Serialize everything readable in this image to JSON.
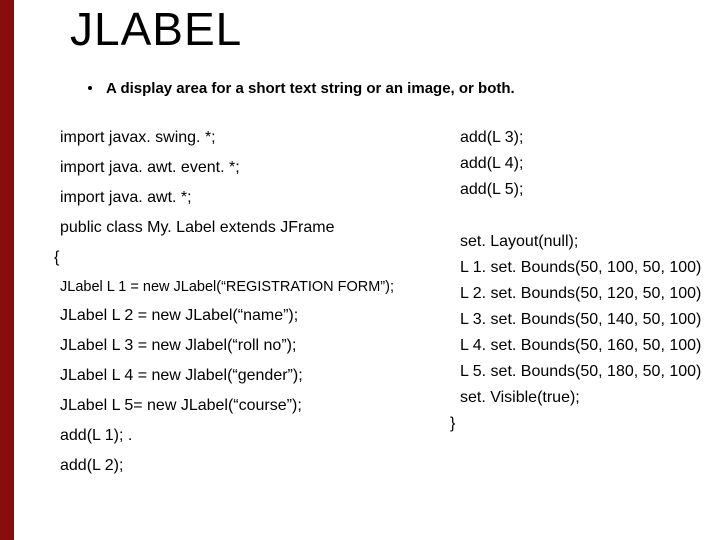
{
  "title": "JLABEL",
  "bullet": "A display area for a short text string or an image, or both.",
  "left": {
    "l1": "import javax. swing. *;",
    "l2": "import java. awt. event. *;",
    "l3": "import java. awt. *;",
    "l4": "public class My. Label extends JFrame",
    "l5": "{",
    "l6": "JLabel L 1 = new JLabel(“REGISTRATION FORM”);",
    "l7": "JLabel L 2 = new JLabel(“name”);",
    "l8": "JLabel L 3 = new Jlabel(“roll no”);",
    "l9": "JLabel L 4 = new Jlabel(“gender”);",
    "l10": "JLabel L 5= new JLabel(“course”);",
    "l11": "add(L 1);   .",
    "l12": "add(L 2);"
  },
  "right": {
    "r1": "add(L 3);",
    "r2": "add(L 4);",
    "r3": "add(L 5);",
    "r4": "set. Layout(null);",
    "r5": "L 1. set. Bounds(50, 100, 50, 100)",
    "r6": "L 2. set. Bounds(50, 120, 50, 100)",
    "r7": "L 3. set. Bounds(50, 140, 50, 100)",
    "r8": "L 4. set. Bounds(50, 160, 50, 100)",
    "r9": "L 5. set. Bounds(50, 180, 50, 100)",
    "r10": "set. Visible(true);",
    "r11": "}"
  }
}
